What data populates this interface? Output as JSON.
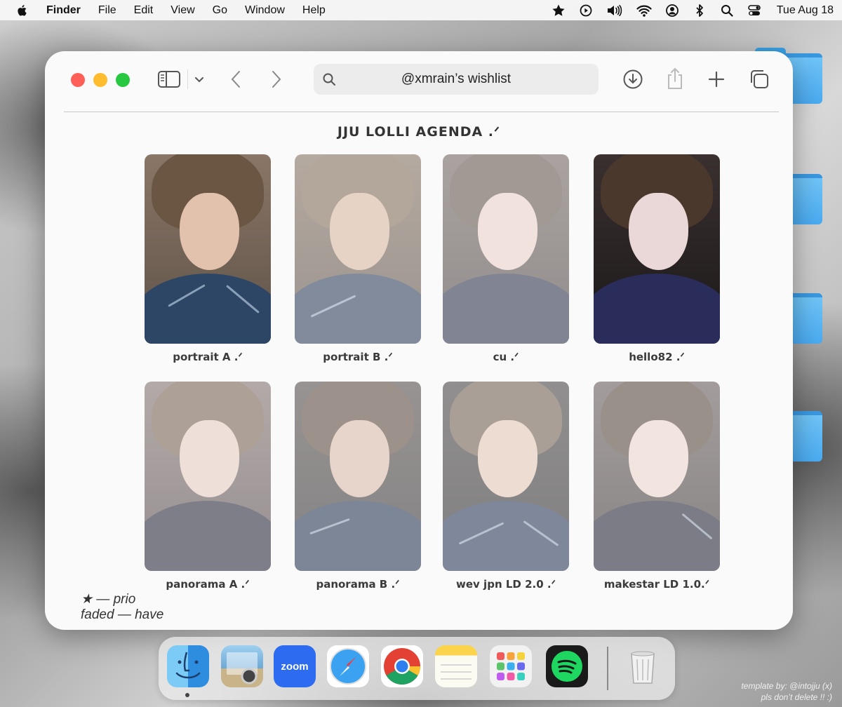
{
  "menubar": {
    "app_name": "Finder",
    "items": [
      "File",
      "Edit",
      "View",
      "Go",
      "Window",
      "Help"
    ],
    "clock": "Tue Aug 18",
    "status_icons": [
      "star-icon",
      "play-circle-icon",
      "volume-icon",
      "wifi-icon",
      "user-circle-icon",
      "bluetooth-icon",
      "search-icon",
      "control-center-icon"
    ]
  },
  "window": {
    "address_title": "@xmrain’s wishlist",
    "heading": "JJU LOLLI AGENDA .ᐟ"
  },
  "cards": [
    {
      "caption": "portrait A .ᐟ",
      "state": "wanted"
    },
    {
      "caption": "portrait B .ᐟ",
      "state": "have"
    },
    {
      "caption": "cu .ᐟ",
      "state": "have"
    },
    {
      "caption": "hello82 .ᐟ",
      "state": "wanted"
    },
    {
      "caption": "panorama A .ᐟ",
      "state": "have"
    },
    {
      "caption": "panorama B .ᐟ",
      "state": "have"
    },
    {
      "caption": "wev jpn LD 2.0 .ᐟ",
      "state": "have"
    },
    {
      "caption": "makestar LD 1.0.ᐟ",
      "state": "have"
    }
  ],
  "legend": {
    "line1": "★ — prio",
    "line2": "faded — have"
  },
  "dock": {
    "apps": [
      "finder",
      "preview",
      "zoom",
      "safari",
      "chrome",
      "notes",
      "launchpad",
      "spotify",
      "trash"
    ],
    "zoom_label": "zoom"
  },
  "credit": {
    "line1": "template by: @intojju (x)",
    "line2": "pls don’t delete !! :)"
  },
  "colors": {
    "close": "#fe5f57",
    "minimize": "#febc2e",
    "maximize": "#28c840",
    "folder": "#4aaaf0"
  }
}
